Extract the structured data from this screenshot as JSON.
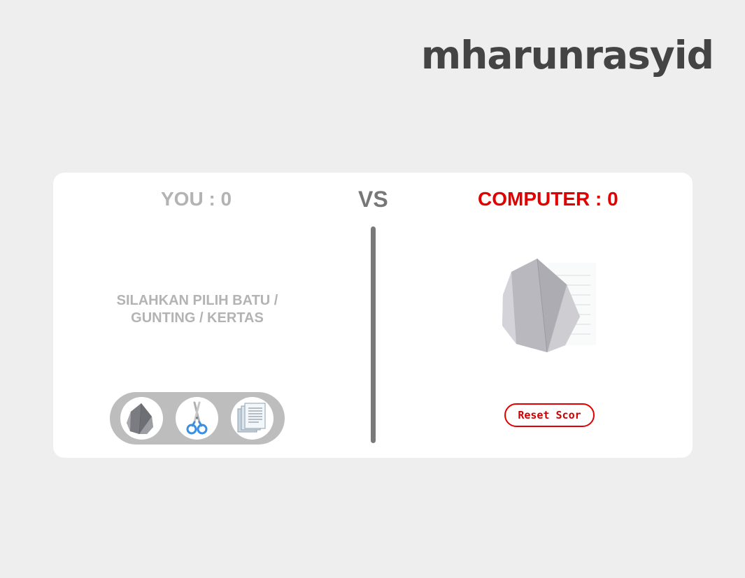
{
  "brand": {
    "title": "mharunrasyid"
  },
  "scoreboard": {
    "player_label": "YOU : 0",
    "vs_label": "VS",
    "computer_label": "COMPUTER : 0",
    "player_score": 0,
    "computer_score": 0
  },
  "player": {
    "instruction": "SILAHKAN PILIH BATU / GUNTING / KERTAS",
    "choices": [
      {
        "name": "batu",
        "icon": "rock-icon"
      },
      {
        "name": "gunting",
        "icon": "scissors-icon"
      },
      {
        "name": "kertas",
        "icon": "paper-icon"
      }
    ]
  },
  "computer": {
    "current_choice": "batu",
    "icon": "rock-icon",
    "reset_label": "Reset Scor"
  },
  "colors": {
    "background": "#eeeeee",
    "card": "#ffffff",
    "accent": "#e00000",
    "muted": "#b3b3b3",
    "brand_text": "#444444",
    "divider": "#7a7a7a",
    "choice_tray": "#bdbdbd"
  }
}
